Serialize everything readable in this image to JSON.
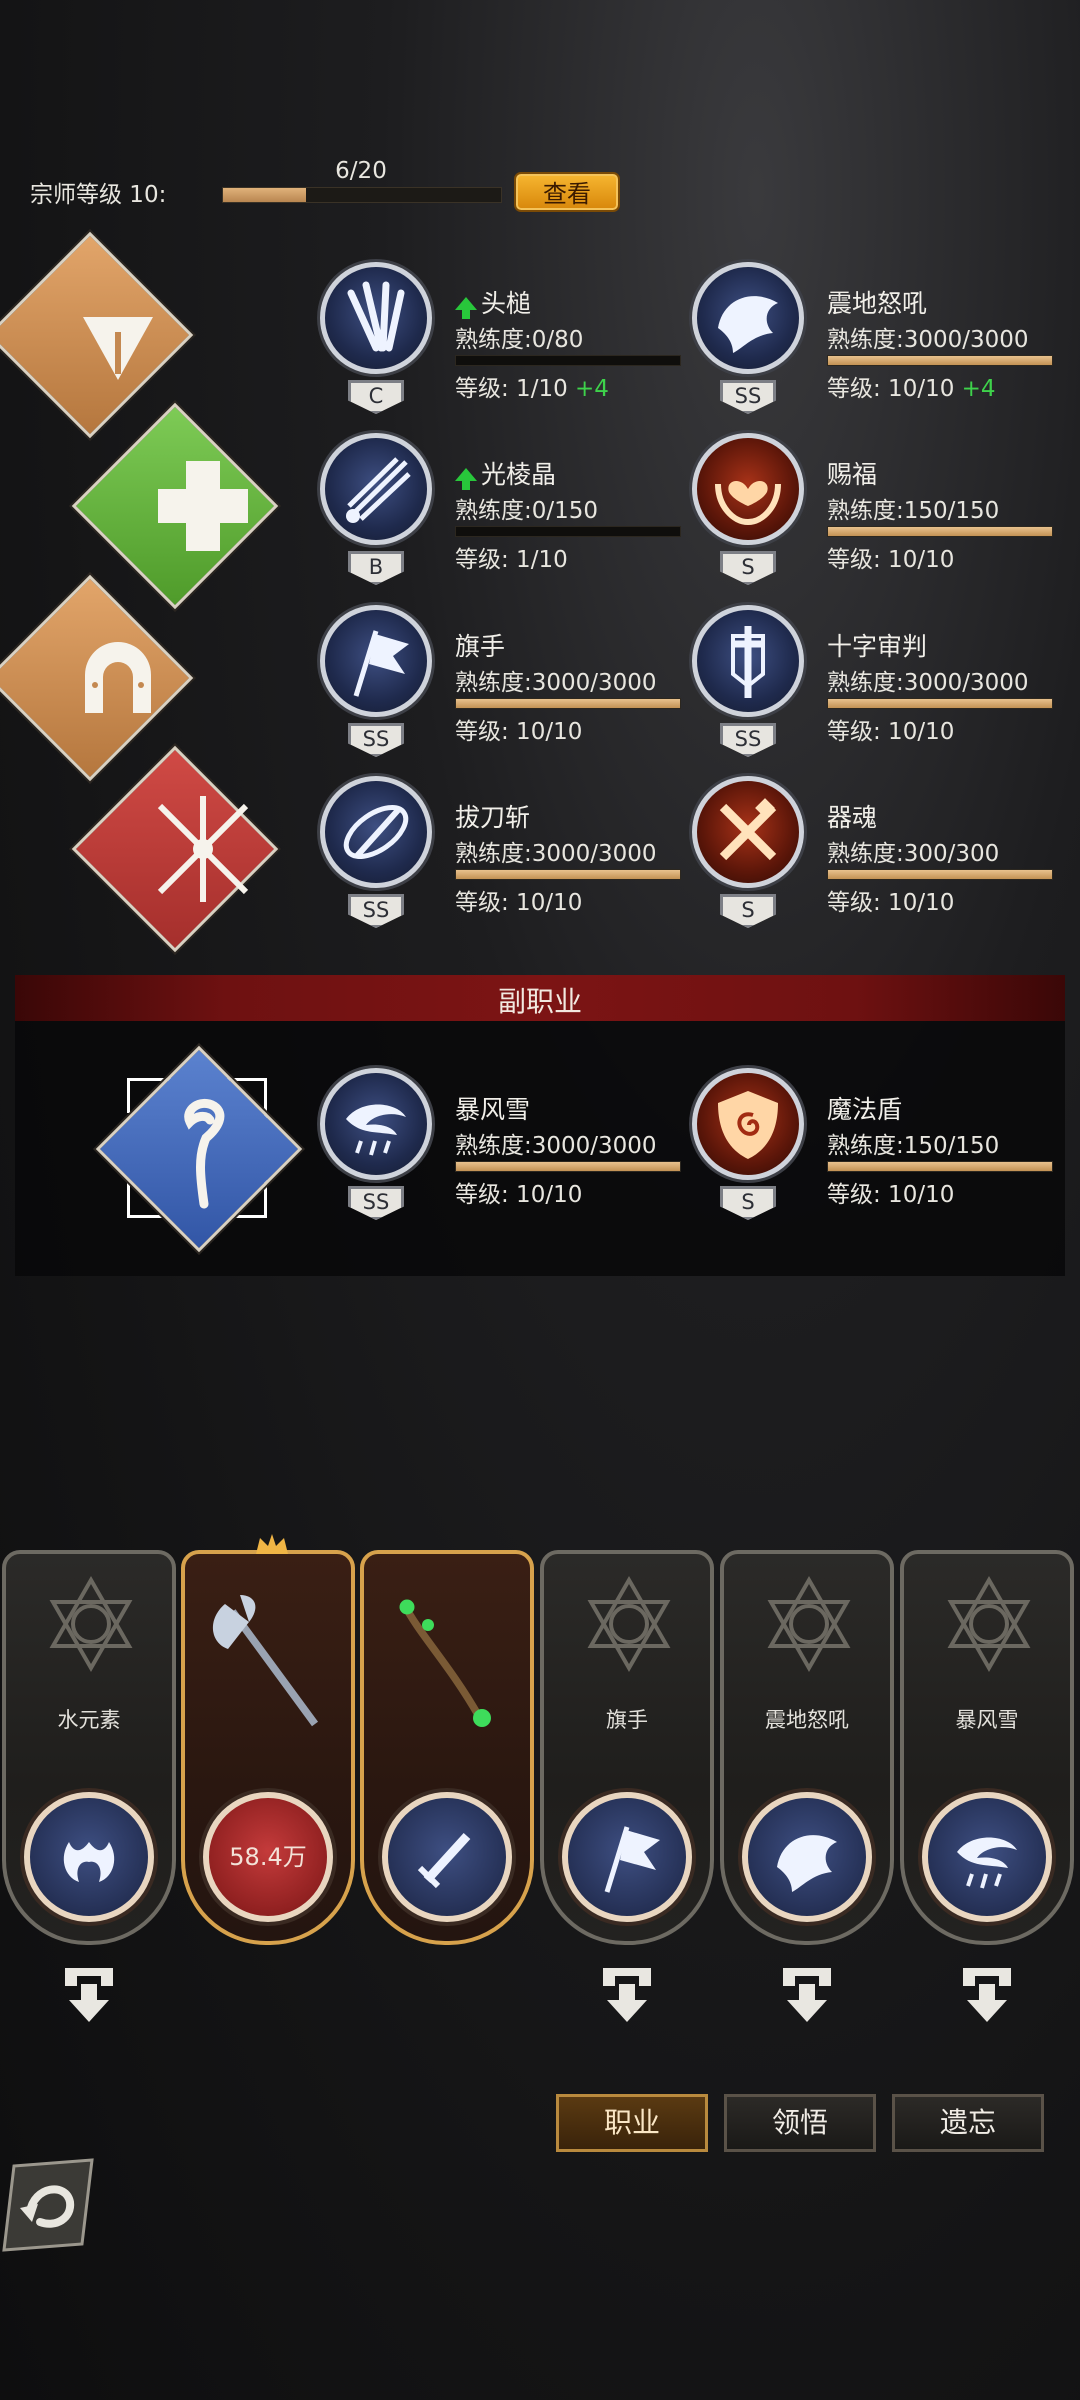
{
  "header": {
    "grandmaster_label": "宗师等级 10:",
    "progress_text": "6/20",
    "progress_fraction": 0.3,
    "view_button": "查看"
  },
  "main_profession": {
    "icons": [
      "triangle-emblem-icon",
      "plus-cross-icon",
      "horseshoe-icon",
      "crossed-swords-icon"
    ],
    "skills": [
      {
        "name": "头槌",
        "upgrade": true,
        "proficiency": "熟练度:0/80",
        "prof_fraction": 0,
        "level": "等级: 1/10",
        "bonus": "+4",
        "grade": "C",
        "orb": "blue",
        "icon": "headbutt-icon"
      },
      {
        "name": "震地怒吼",
        "upgrade": false,
        "proficiency": "熟练度:3000/3000",
        "prof_fraction": 1,
        "level": "等级: 10/10",
        "bonus": "+4",
        "grade": "SS",
        "orb": "blue",
        "icon": "earthquake-roar-icon"
      },
      {
        "name": "光棱晶",
        "upgrade": true,
        "proficiency": "熟练度:0/150",
        "prof_fraction": 0,
        "level": "等级: 1/10",
        "bonus": "",
        "grade": "B",
        "orb": "blue",
        "icon": "prism-crystal-icon"
      },
      {
        "name": "赐福",
        "upgrade": false,
        "proficiency": "熟练度:150/150",
        "prof_fraction": 1,
        "level": "等级: 10/10",
        "bonus": "",
        "grade": "S",
        "orb": "red",
        "icon": "blessing-icon"
      },
      {
        "name": "旗手",
        "upgrade": false,
        "proficiency": "熟练度:3000/3000",
        "prof_fraction": 1,
        "level": "等级: 10/10",
        "bonus": "",
        "grade": "SS",
        "orb": "blue",
        "icon": "flag-icon"
      },
      {
        "name": "十字审判",
        "upgrade": false,
        "proficiency": "熟练度:3000/3000",
        "prof_fraction": 1,
        "level": "等级: 10/10",
        "bonus": "",
        "grade": "SS",
        "orb": "blue",
        "icon": "cross-judgment-icon"
      },
      {
        "name": "拔刀斩",
        "upgrade": false,
        "proficiency": "熟练度:3000/3000",
        "prof_fraction": 1,
        "level": "等级: 10/10",
        "bonus": "",
        "grade": "SS",
        "orb": "blue",
        "icon": "sword-slash-icon"
      },
      {
        "name": "器魂",
        "upgrade": false,
        "proficiency": "熟练度:300/300",
        "prof_fraction": 1,
        "level": "等级: 10/10",
        "bonus": "",
        "grade": "S",
        "orb": "red",
        "icon": "weapon-soul-icon"
      }
    ]
  },
  "sub_profession": {
    "title": "副职业",
    "icon": "magic-staff-icon",
    "skills": [
      {
        "name": "暴风雪",
        "proficiency": "熟练度:3000/3000",
        "prof_fraction": 1,
        "level": "等级: 10/10",
        "grade": "SS",
        "orb": "blue",
        "icon": "blizzard-icon"
      },
      {
        "name": "魔法盾",
        "proficiency": "熟练度:150/150",
        "prof_fraction": 1,
        "level": "等级: 10/10",
        "grade": "S",
        "orb": "red",
        "icon": "magic-shield-icon"
      }
    ]
  },
  "loadout": [
    {
      "label": "水元素",
      "icon": "water-elemental-icon"
    },
    {
      "label": "58.4万",
      "icon": "battle-axe-icon"
    },
    {
      "label": "",
      "icon": "wooden-staff-icon"
    },
    {
      "label": "旗手",
      "icon": "flag-icon"
    },
    {
      "label": "震地怒吼",
      "icon": "earthquake-roar-icon"
    },
    {
      "label": "暴风雪",
      "icon": "blizzard-icon"
    }
  ],
  "tabs": [
    "职业",
    "领悟",
    "遗忘"
  ],
  "active_tab": "职业"
}
